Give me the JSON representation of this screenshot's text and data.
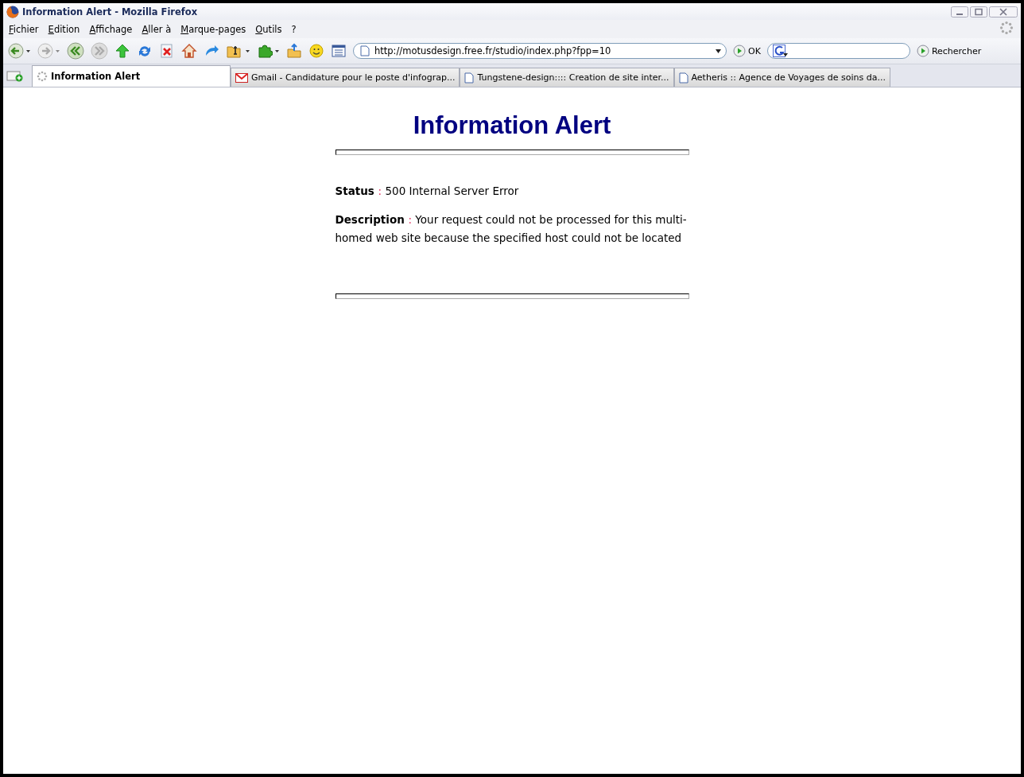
{
  "window": {
    "title": "Information Alert - Mozilla Firefox"
  },
  "menu": [
    "Fichier",
    "Edition",
    "Affichage",
    "Aller à",
    "Marque-pages",
    "Outils",
    "?"
  ],
  "address_bar": {
    "value": "http://motusdesign.free.fr/studio/index.php?fpp=10",
    "go_label": "OK"
  },
  "search_bar": {
    "button_label": "Rechercher"
  },
  "tabs": [
    {
      "label": "Information Alert",
      "selected": true,
      "kind": "loading"
    },
    {
      "label": "Gmail - Candidature pour le poste d'infograp...",
      "selected": false,
      "kind": "mail"
    },
    {
      "label": "Tungstene-design:::: Creation de site inter...",
      "selected": false,
      "kind": "page"
    },
    {
      "label": "Aetheris :: Agence de Voyages de soins da...",
      "selected": false,
      "kind": "page"
    }
  ],
  "page": {
    "heading": "Information Alert",
    "fields": [
      {
        "label": "Status",
        "separator": ":",
        "value": "500 Internal Server Error"
      },
      {
        "label": "Description",
        "separator": ":",
        "value": "Your request could not be processed for this multi-homed web site because the specified host could not be located"
      }
    ]
  }
}
